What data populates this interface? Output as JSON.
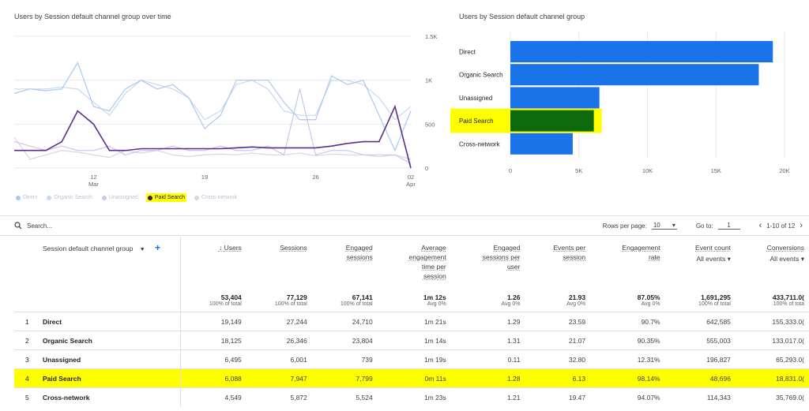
{
  "line_chart": {
    "title": "Users by Session default channel group over time",
    "y_ticks": [
      "1.5K",
      "1K",
      "500",
      "0"
    ],
    "x_ticks": [
      {
        "day": "12",
        "month": "Mar"
      },
      {
        "day": "19",
        "month": ""
      },
      {
        "day": "26",
        "month": ""
      },
      {
        "day": "02",
        "month": "Apr"
      }
    ],
    "legend": [
      {
        "label": "Direct",
        "color": "#aac8f0",
        "highlight": false
      },
      {
        "label": "Organic Search",
        "color": "#c5d9f2",
        "highlight": false
      },
      {
        "label": "Unassigned",
        "color": "#c8c8ec",
        "highlight": false
      },
      {
        "label": "Paid Search",
        "color": "#5b2d90",
        "highlight": true
      },
      {
        "label": "Cross-network",
        "color": "#e0cfe8",
        "highlight": false
      }
    ]
  },
  "bar_chart": {
    "title": "Users by Session default channel group",
    "highlight_color": "#ffff00",
    "bar_color": "#1a73e8",
    "highlight_bar_color": "#0d6b0d",
    "x_ticks": [
      "0",
      "5K",
      "10K",
      "15K",
      "20K"
    ]
  },
  "chart_data": [
    {
      "type": "line",
      "title": "Users by Session default channel group over time",
      "x_labels": [
        "12 Mar",
        "19",
        "26",
        "02 Apr"
      ],
      "ylim": [
        0,
        1500
      ],
      "series": [
        {
          "name": "Direct",
          "values": [
            850,
            900,
            880,
            900,
            1200,
            700,
            650,
            900,
            1000,
            900,
            950,
            800,
            450,
            600,
            1000,
            1000,
            1000,
            750,
            550,
            550,
            1050,
            950,
            1000,
            600,
            200,
            650
          ]
        },
        {
          "name": "Organic Search",
          "values": [
            900,
            900,
            900,
            920,
            900,
            750,
            600,
            850,
            1000,
            950,
            900,
            800,
            550,
            650,
            950,
            1000,
            900,
            650,
            600,
            600,
            1000,
            1000,
            950,
            800,
            550,
            700
          ]
        },
        {
          "name": "Unassigned",
          "values": [
            300,
            250,
            200,
            250,
            200,
            200,
            250,
            150,
            200,
            200,
            250,
            200,
            200,
            250,
            200,
            200,
            250,
            150,
            900,
            150,
            200,
            200,
            150,
            150,
            150,
            50
          ]
        },
        {
          "name": "Paid Search",
          "values": [
            200,
            200,
            200,
            300,
            650,
            500,
            200,
            200,
            220,
            220,
            220,
            220,
            220,
            220,
            230,
            240,
            230,
            230,
            230,
            230,
            250,
            280,
            300,
            300,
            700,
            0
          ]
        },
        {
          "name": "Cross-network",
          "values": [
            350,
            100,
            150,
            200,
            180,
            150,
            120,
            200,
            170,
            200,
            150,
            130,
            150,
            160,
            150,
            170,
            150,
            150,
            170,
            140,
            160,
            150,
            150,
            130,
            150,
            100
          ]
        }
      ]
    },
    {
      "type": "bar",
      "title": "Users by Session default channel group",
      "categories": [
        "Direct",
        "Organic Search",
        "Unassigned",
        "Paid Search",
        "Cross-network"
      ],
      "values": [
        19149,
        18125,
        6495,
        6088,
        4549
      ],
      "xlim": [
        0,
        20000
      ]
    }
  ],
  "toolbar": {
    "search_placeholder": "Search...",
    "rows_per_page_label": "Rows per page:",
    "rows_per_page_value": "10",
    "goto_label": "Go to:",
    "goto_value": "1",
    "page_range": "1-10 of 12"
  },
  "table": {
    "dimension_header": "Session default channel group",
    "headers": [
      {
        "lines": [
          "↓ Users"
        ]
      },
      {
        "lines": [
          "Sessions"
        ]
      },
      {
        "lines": [
          "Engaged",
          "sessions"
        ]
      },
      {
        "lines": [
          "Average",
          "engagement",
          "time per",
          "session"
        ]
      },
      {
        "lines": [
          "Engaged",
          "sessions per",
          "user"
        ]
      },
      {
        "lines": [
          "Events per",
          "session"
        ]
      },
      {
        "lines": [
          "Engagement",
          "rate"
        ]
      },
      {
        "lines": [
          "Event count"
        ],
        "sub": "All events"
      },
      {
        "lines": [
          "Conversions"
        ],
        "sub": "All events"
      }
    ],
    "totals": [
      {
        "value": "53,404",
        "sub": "100% of total"
      },
      {
        "value": "77,129",
        "sub": "100% of total"
      },
      {
        "value": "67,141",
        "sub": "100% of total"
      },
      {
        "value": "1m 12s",
        "sub": "Avg 0%"
      },
      {
        "value": "1.26",
        "sub": "Avg 0%"
      },
      {
        "value": "21.93",
        "sub": "Avg 0%"
      },
      {
        "value": "87.05%",
        "sub": "Avg 0%"
      },
      {
        "value": "1,691,295",
        "sub": "100% of total"
      },
      {
        "value": "433,711.0(",
        "sub": "100% of tota"
      }
    ],
    "rows": [
      {
        "idx": "1",
        "name": "Direct",
        "values": [
          "19,149",
          "27,244",
          "24,710",
          "1m 21s",
          "1.29",
          "23.59",
          "90.7%",
          "642,585",
          "155,333.0("
        ],
        "highlight": false
      },
      {
        "idx": "2",
        "name": "Organic Search",
        "values": [
          "18,125",
          "26,346",
          "23,804",
          "1m 14s",
          "1.31",
          "21.07",
          "90.35%",
          "555,003",
          "133,017.0("
        ],
        "highlight": false
      },
      {
        "idx": "3",
        "name": "Unassigned",
        "values": [
          "6,495",
          "6,001",
          "739",
          "1m 19s",
          "0.11",
          "32.80",
          "12.31%",
          "196,827",
          "65,293.0("
        ],
        "highlight": false
      },
      {
        "idx": "4",
        "name": "Paid Search",
        "values": [
          "6,088",
          "7,947",
          "7,799",
          "0m 11s",
          "1.28",
          "6.13",
          "98.14%",
          "48,696",
          "18,831.0("
        ],
        "highlight": true
      },
      {
        "idx": "5",
        "name": "Cross-network",
        "values": [
          "4,549",
          "5,872",
          "5,524",
          "1m 23s",
          "1.21",
          "19.47",
          "94.07%",
          "114,343",
          "35,769.0("
        ],
        "highlight": false
      }
    ]
  }
}
